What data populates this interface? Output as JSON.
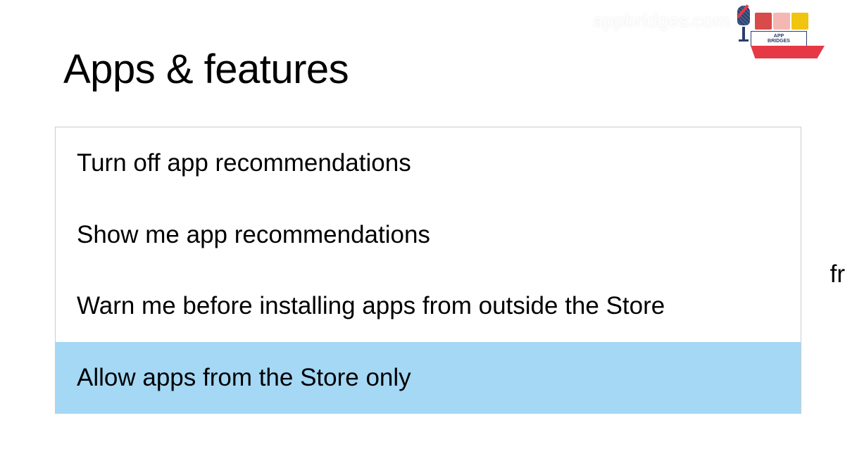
{
  "header": {
    "title": "Apps & features"
  },
  "dropdown": {
    "items": [
      {
        "label": "Turn off app recommendations",
        "selected": false
      },
      {
        "label": "Show me app recommendations",
        "selected": false
      },
      {
        "label": "Warn me before installing apps from outside the Store",
        "selected": false
      },
      {
        "label": "Allow apps from the Store only",
        "selected": true
      }
    ]
  },
  "cutoff": "fr",
  "watermark": {
    "text": "appbridges.com",
    "logo_top_text": "APP",
    "logo_bottom_text": "BRIDGES"
  }
}
